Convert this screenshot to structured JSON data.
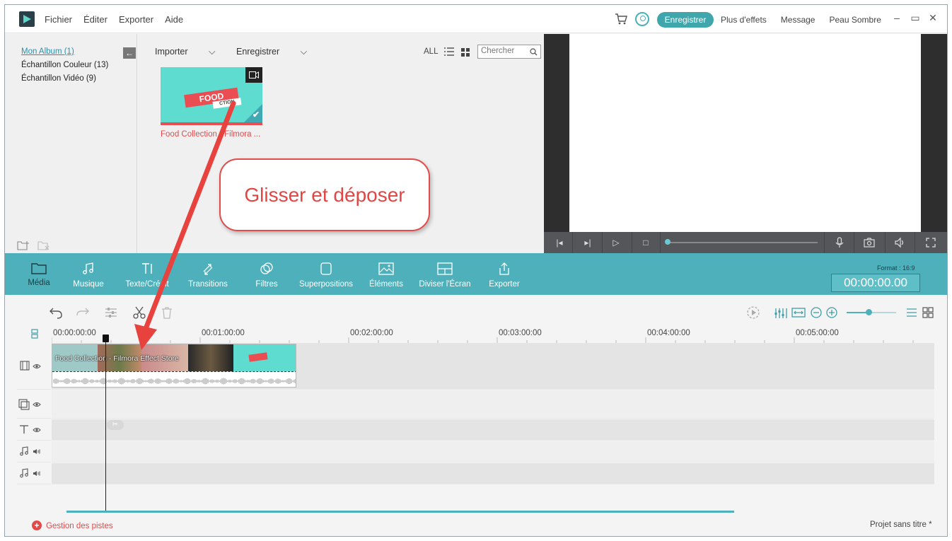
{
  "menu": [
    "Fichier",
    "Éditer",
    "Exporter",
    "Aide"
  ],
  "top_bar": {
    "register_button": "Enregistrer",
    "links": [
      "Plus d'effets",
      "Message",
      "Peau Sombre"
    ]
  },
  "albums": {
    "items": [
      "Mon Album (1)",
      "Échantillon Couleur (13)",
      "Échantillon Vidéo (9)"
    ],
    "active_index": 0
  },
  "media": {
    "import_label": "Importer",
    "record_label": "Enregistrer",
    "filter_label": "ALL",
    "search_placeholder": "Chercher",
    "items": [
      {
        "label": "Food Collection - Filmora ...",
        "banner": "FOOD",
        "subbanner": "CTION"
      }
    ]
  },
  "toolbar": {
    "tools": [
      "Média",
      "Musique",
      "Texte/Crédit",
      "Transitions",
      "Filtres",
      "Superpositions",
      "Éléments",
      "Diviser l'Écran",
      "Exporter"
    ],
    "active_index": 0,
    "format_label": "Format : 16:9",
    "timecode": "00:00:00.00"
  },
  "timeline": {
    "ruler": [
      "00:00:00:00",
      "00:01:00:00",
      "00:02:00:00",
      "00:03:00:00",
      "00:04:00:00",
      "00:05:00:00"
    ],
    "clip_title": "Food Collection - Filmora Effect Store"
  },
  "footer": {
    "track_management": "Gestion des pistes",
    "project_title": "Projet sans titre *"
  },
  "annotation": {
    "text": "Glisser et déposer"
  },
  "colors": {
    "accent": "#4eb0ba",
    "annotation_red": "#e34545"
  }
}
